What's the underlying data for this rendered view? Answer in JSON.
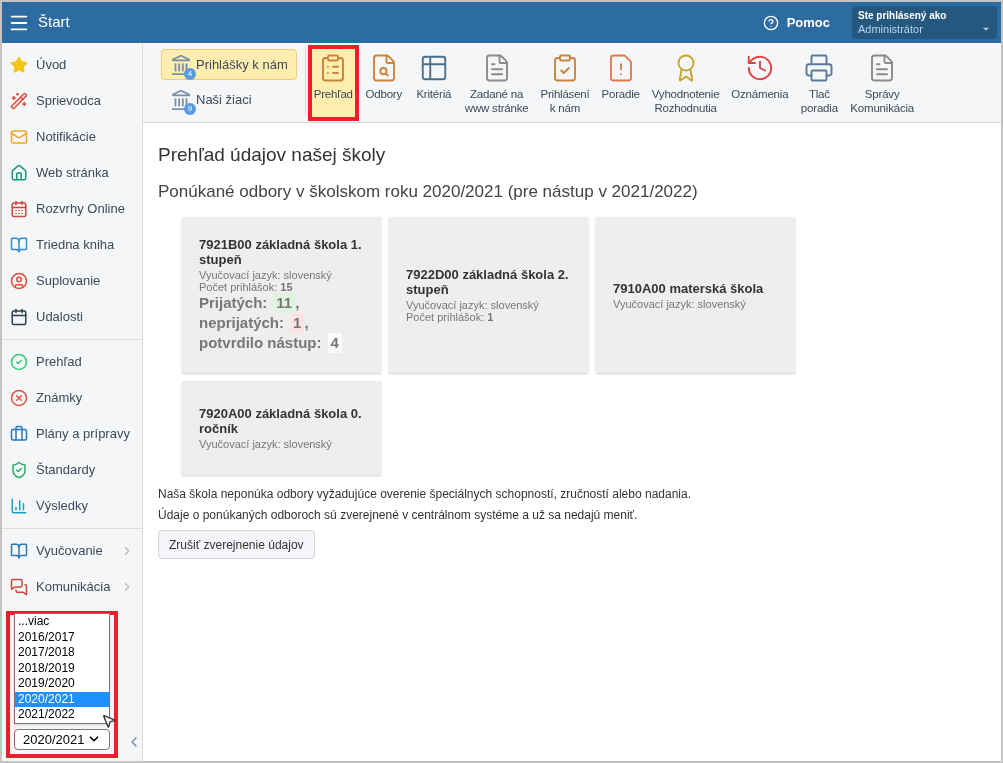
{
  "header": {
    "title": "Štart",
    "help": "Pomoc",
    "user_caption": "Ste prihlásený ako",
    "user_name": "Administrátor"
  },
  "sidebar": {
    "groups": [
      [
        {
          "label": "Úvod",
          "has_submenu": false
        },
        {
          "label": "Sprievodca",
          "has_submenu": false
        },
        {
          "label": "Notifikácie",
          "has_submenu": false
        },
        {
          "label": "Web stránka",
          "has_submenu": false
        },
        {
          "label": "Rozvrhy Online",
          "has_submenu": false
        },
        {
          "label": "Triedna kniha",
          "has_submenu": false
        },
        {
          "label": "Suplovanie",
          "has_submenu": false
        },
        {
          "label": "Udalosti",
          "has_submenu": false
        }
      ],
      [
        {
          "label": "Prehľad",
          "has_submenu": false
        },
        {
          "label": "Známky",
          "has_submenu": false
        },
        {
          "label": "Plány a prípravy",
          "has_submenu": false
        },
        {
          "label": "Štandardy",
          "has_submenu": false
        },
        {
          "label": "Výsledky",
          "has_submenu": false
        }
      ],
      [
        {
          "label": "Vyučovanie",
          "has_submenu": true
        },
        {
          "label": "Komunikácia",
          "has_submenu": true
        }
      ]
    ],
    "year_select": {
      "value": "2020/2021",
      "highlighted": true,
      "options": [
        {
          "label": "...viac",
          "selected": false
        },
        {
          "label": "2016/2017",
          "selected": false
        },
        {
          "label": "2017/2018",
          "selected": false
        },
        {
          "label": "2018/2019",
          "selected": false
        },
        {
          "label": "2019/2020",
          "selected": false
        },
        {
          "label": "2020/2021",
          "selected": true
        },
        {
          "label": "2021/2022",
          "selected": false
        }
      ]
    }
  },
  "toolbar": {
    "modes": [
      {
        "label": "Prihlášky k nám",
        "badge": "4",
        "selected": true
      },
      {
        "label": "Naši žiaci",
        "badge": "9",
        "selected": false
      }
    ],
    "tools": [
      {
        "label": "Prehľad",
        "selected": true,
        "highlighted": true
      },
      {
        "label": "Odbory",
        "selected": false,
        "highlighted": false
      },
      {
        "label": "Kritériá",
        "selected": false,
        "highlighted": false
      },
      {
        "label": "Zadané na\nwww stránke",
        "selected": false,
        "highlighted": false
      },
      {
        "label": "Prihlásení\nk nám",
        "selected": false,
        "highlighted": false
      },
      {
        "label": "Poradie",
        "selected": false,
        "highlighted": false
      },
      {
        "label": "Vyhodnotenie\nRozhodnutia",
        "selected": false,
        "highlighted": false
      },
      {
        "label": "Oznámenia",
        "selected": false,
        "highlighted": false
      },
      {
        "label": "Tlač\nporadia",
        "selected": false,
        "highlighted": false
      },
      {
        "label": "Správy\nKomunikácia",
        "selected": false,
        "highlighted": false
      }
    ]
  },
  "content": {
    "title": "Prehľad údajov našej školy",
    "subtitle": "Ponúkané odbory v školskom roku 2020/2021 (pre nástup v 2021/2022)",
    "cards": [
      {
        "title": "7921B00 základná škola 1. stupeň",
        "language": "Vyučovací jazyk: slovenský",
        "applications_label": "Počet prihlášok:",
        "applications": "15",
        "stats": [
          {
            "label": "Prijatých:",
            "value": "11",
            "separator": ",",
            "color": "#dff5df"
          },
          {
            "label": "neprijatých:",
            "value": "1",
            "separator": ",",
            "color": "#fbe3e3"
          },
          {
            "label": "potvrdilo nástup:",
            "value": "4",
            "color": "#fafafa"
          }
        ]
      },
      {
        "title": "7922D00 základná škola 2. stupeň",
        "language": "Vyučovací jazyk: slovenský",
        "applications_label": "Počet prihlášok:",
        "applications": "1"
      },
      {
        "title": "7910A00 materská škola",
        "language": "Vyučovací jazyk: slovenský"
      },
      {
        "title": "7920A00 základná škola 0. ročník",
        "language": "Vyučovací jazyk: slovenský"
      }
    ],
    "notes": [
      "Naša škola neponúka odbory vyžadujúce overenie špeciálnych schopností, zručností alebo nadania.",
      "Údaje o ponúkaných odboroch sú zverejnené v centrálnom systéme a už sa nedajú meniť."
    ],
    "button": "Zrušiť zverejnenie údajov"
  }
}
